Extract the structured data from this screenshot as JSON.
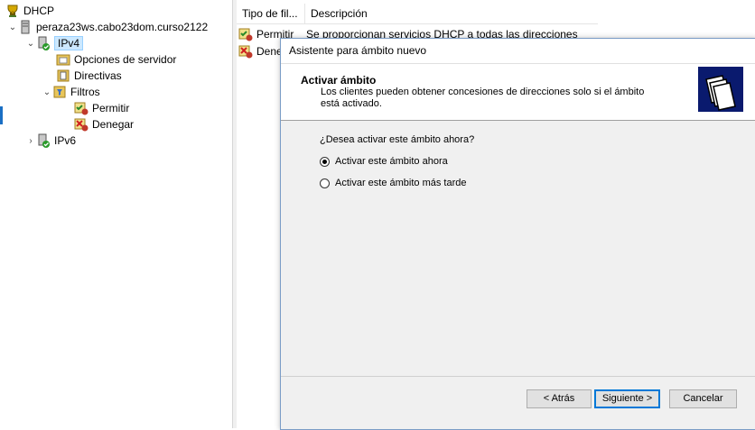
{
  "tree": {
    "root": "DHCP",
    "server": "peraza23ws.cabo23dom.curso2122",
    "ipv4": "IPv4",
    "server_options": "Opciones de servidor",
    "policies": "Directivas",
    "filters": "Filtros",
    "allow": "Permitir",
    "deny": "Denegar",
    "ipv6": "IPv6"
  },
  "list": {
    "columns": [
      "Tipo de fil...",
      "Descripción"
    ],
    "rows": [
      {
        "type": "Permitir",
        "description": "Se proporcionan servicios DHCP a todas las direcciones"
      },
      {
        "type": "Dene",
        "description": ""
      }
    ]
  },
  "wizard": {
    "title": "Asistente para ámbito nuevo",
    "header_title": "Activar ámbito",
    "header_subtitle": "Los clientes pueden obtener concesiones de direcciones solo si el ámbito está activado.",
    "question": "¿Desea activar este ámbito ahora?",
    "options": [
      {
        "label": "Activar este ámbito ahora",
        "selected": true
      },
      {
        "label": "Activar este ámbito más tarde",
        "selected": false
      }
    ],
    "buttons": {
      "back": "< Atrás",
      "next": "Siguiente >",
      "cancel": "Cancelar"
    }
  },
  "colors": {
    "selection": "#cce8ff",
    "accent": "#0078d7",
    "icon_bg": "#0a1a6e"
  }
}
